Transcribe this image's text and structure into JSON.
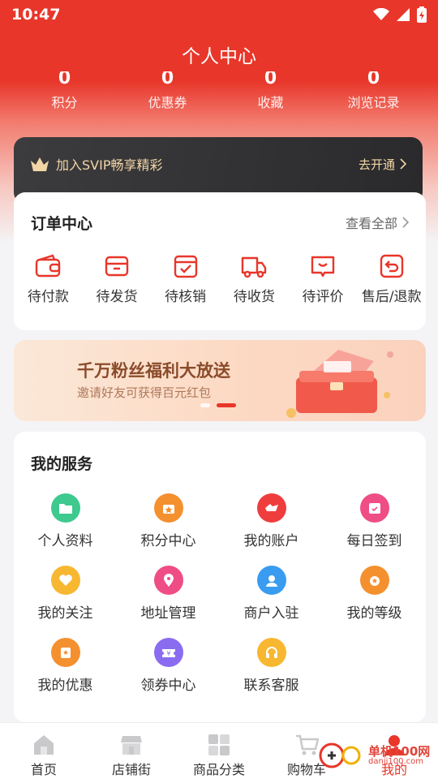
{
  "status": {
    "time": "10:47"
  },
  "header": {
    "title": "个人中心"
  },
  "stats": [
    {
      "value": "0",
      "label": "积分"
    },
    {
      "value": "0",
      "label": "优惠券"
    },
    {
      "value": "0",
      "label": "收藏"
    },
    {
      "value": "0",
      "label": "浏览记录"
    }
  ],
  "svip": {
    "text": "加入SVIP畅享精彩",
    "action": "去开通"
  },
  "orders": {
    "title": "订单中心",
    "more": "查看全部",
    "items": [
      {
        "label": "待付款",
        "icon": "wallet-icon"
      },
      {
        "label": "待发货",
        "icon": "box-icon"
      },
      {
        "label": "待核销",
        "icon": "verify-icon"
      },
      {
        "label": "待收货",
        "icon": "truck-icon"
      },
      {
        "label": "待评价",
        "icon": "comment-icon"
      },
      {
        "label": "售后/退款",
        "icon": "refund-icon"
      }
    ]
  },
  "banner": {
    "title": "千万粉丝福利大放送",
    "subtitle": "邀请好友可获得百元红包",
    "slide_count": 2,
    "active_slide": 2
  },
  "services": {
    "title": "我的服务",
    "items": [
      {
        "label": "个人资料",
        "icon": "folder-icon",
        "color": "#3ec98f"
      },
      {
        "label": "积分中心",
        "icon": "points-icon",
        "color": "#f5902f"
      },
      {
        "label": "我的账户",
        "icon": "account-icon",
        "color": "#ef3d3d"
      },
      {
        "label": "每日签到",
        "icon": "calendar-icon",
        "color": "#ef4d86"
      },
      {
        "label": "我的关注",
        "icon": "heart-icon",
        "color": "#f7b731"
      },
      {
        "label": "地址管理",
        "icon": "location-icon",
        "color": "#ef4d86"
      },
      {
        "label": "商户入驻",
        "icon": "merchant-icon",
        "color": "#3a9cf0"
      },
      {
        "label": "我的等级",
        "icon": "medal-icon",
        "color": "#f5902f"
      },
      {
        "label": "我的优惠",
        "icon": "coupon-icon",
        "color": "#f5902f"
      },
      {
        "label": "领券中心",
        "icon": "voucher-icon",
        "color": "#8a6cf0"
      },
      {
        "label": "联系客服",
        "icon": "headset-icon",
        "color": "#f7b731"
      }
    ]
  },
  "tabbar": [
    {
      "label": "首页",
      "icon": "home-icon"
    },
    {
      "label": "店铺街",
      "icon": "store-icon"
    },
    {
      "label": "商品分类",
      "icon": "category-icon"
    },
    {
      "label": "购物车",
      "icon": "cart-icon"
    },
    {
      "label": "我的",
      "icon": "profile-icon",
      "active": true
    }
  ],
  "watermark": {
    "line1": "单机100网",
    "line2": "danji100.com"
  },
  "colors": {
    "brand": "#e8362a",
    "svip_text": "#f3d6a6"
  }
}
